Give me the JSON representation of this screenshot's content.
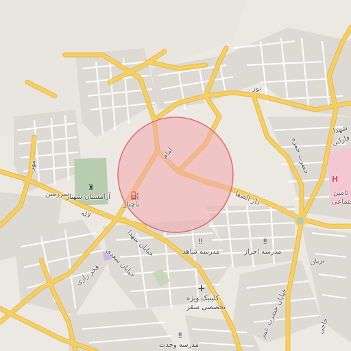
{
  "map": {
    "colors": {
      "background": "#ece9e3",
      "road_major": "#f6cf63",
      "road_major_casing": "#e6b94a",
      "road_minor": "#ffffff",
      "park": "#b8cdb0",
      "hospital": "#f3c7d3",
      "highlight_fill": "#f2a7ad",
      "highlight_stroke": "#e06b73"
    },
    "highlight_circle": {
      "label": "search-area"
    },
    "street_labels": [
      {
        "id": "noor",
        "text": "نور"
      },
      {
        "id": "imam",
        "text": "امام"
      },
      {
        "id": "dar-alsafa",
        "text": "دار الصفا"
      },
      {
        "id": "hazrat-hamzeh",
        "text": "حضرت حمزه"
      },
      {
        "id": "farabi",
        "text": "فارابی"
      },
      {
        "id": "khiaban-shohada",
        "text": "خیابان شهدا"
      },
      {
        "id": "khiaban-saadi",
        "text": "خیابان سعدی"
      },
      {
        "id": "fakhr-razi",
        "text": "فخر رازی"
      },
      {
        "id": "hazrat-omar",
        "text": "خیابان حضرت عمر"
      },
      {
        "id": "beryan",
        "text": "بریان"
      },
      {
        "id": "lale",
        "text": "لاله"
      },
      {
        "id": "mehr",
        "text": "مهر"
      },
      {
        "id": "shohada-east",
        "text": "شهدا"
      },
      {
        "id": "jadeh",
        "text": "حاجی"
      }
    ],
    "pois": [
      {
        "id": "azmestan",
        "text": "آزامستان شهناز",
        "icon": "landmark-icon"
      },
      {
        "id": "pachnar",
        "text": "پاچنار",
        "icon": "fuel-icon"
      },
      {
        "id": "madrese-shahed",
        "text": "مدرسه شاهد",
        "icon": "school-icon"
      },
      {
        "id": "madrese-ahraz",
        "text": "مدرسه احراز",
        "icon": "school-icon"
      },
      {
        "id": "clinic-line1",
        "text": "کلینیک ویژه",
        "icon": "hospital-icon"
      },
      {
        "id": "clinic-line2",
        "text": "تخصصی سقز",
        "icon": ""
      },
      {
        "id": "madrese-vahdat",
        "text": "مدرسه وحدت",
        "icon": "school-icon"
      },
      {
        "id": "ejtemaei",
        "text": "اجتماعی",
        "icon": ""
      },
      {
        "id": "taminejtemaei",
        "text": "تامین",
        "icon": ""
      },
      {
        "id": "sarzamin",
        "text": "سرزمین",
        "icon": ""
      }
    ]
  }
}
